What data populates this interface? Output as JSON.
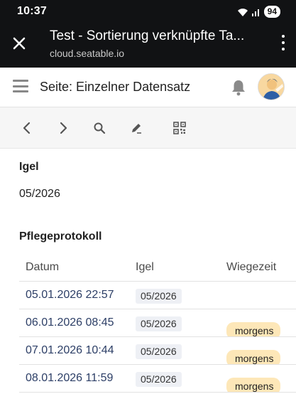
{
  "status": {
    "time": "10:37",
    "battery": "94"
  },
  "tab": {
    "title": "Test - Sortierung verknüpfte Ta...",
    "url": "cloud.seatable.io"
  },
  "header": {
    "title": "Seite: Einzelner Datensatz"
  },
  "toolbar": {
    "icons": [
      "chevron-left-icon",
      "chevron-right-icon",
      "search-icon",
      "edit-icon",
      "qr-code-icon"
    ]
  },
  "record": {
    "field1_label": "Igel",
    "field1_value": "05/2026",
    "table_label": "Pflegeprotokoll",
    "columns": [
      "Datum",
      "Igel",
      "Wiegezeit"
    ],
    "rows": [
      {
        "datum": "05.01.2026 22:57",
        "igel": "05/2026",
        "wiegezeit": ""
      },
      {
        "datum": "06.01.2026 08:45",
        "igel": "05/2026",
        "wiegezeit": "morgens"
      },
      {
        "datum": "07.01.2026 10:44",
        "igel": "05/2026",
        "wiegezeit": "morgens"
      },
      {
        "datum": "08.01.2026 11:59",
        "igel": "05/2026",
        "wiegezeit": "morgens"
      }
    ]
  },
  "colors": {
    "accent_tag": "#fde7b8",
    "link_text": "#2c3e66",
    "topbar": "#111214"
  }
}
